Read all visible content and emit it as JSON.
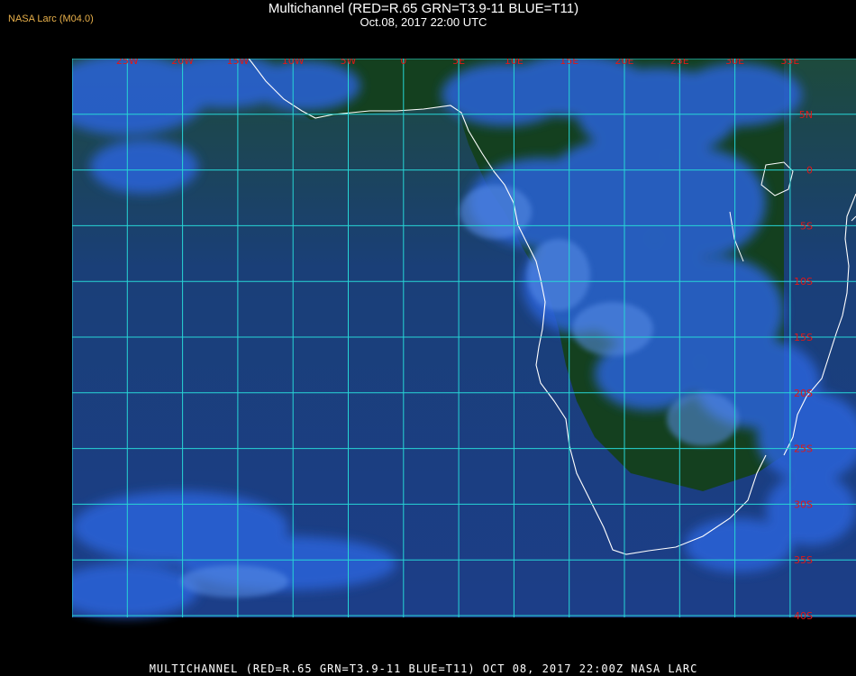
{
  "credit": "NASA Larc (M04.0)",
  "title_line1": "Multichannel (RED=R.65 GRN=T3.9-11 BLUE=T11)",
  "title_line2": "Oct.08, 2017 22:00 UTC",
  "footer": "MULTICHANNEL (RED=R.65 GRN=T3.9-11 BLUE=T11) OCT 08, 2017 22:00Z   NASA LARC",
  "lon_labels": [
    "25W",
    "20W",
    "15W",
    "10W",
    "5W",
    "0",
    "5E",
    "10E",
    "15E",
    "20E",
    "25E",
    "30E",
    "35E"
  ],
  "lat_labels": [
    "5N",
    "0",
    "5S",
    "10S",
    "15S",
    "20S",
    "25S",
    "30S",
    "35S",
    "40S"
  ],
  "colors": {
    "background": "#000000",
    "ocean": "#1c3e8a",
    "land": "#123a1c",
    "cloud": "#2f6fe6",
    "grid": "#27d6d6",
    "coast": "#ffffff",
    "label": "#e01818",
    "credit": "#e8b04a"
  }
}
